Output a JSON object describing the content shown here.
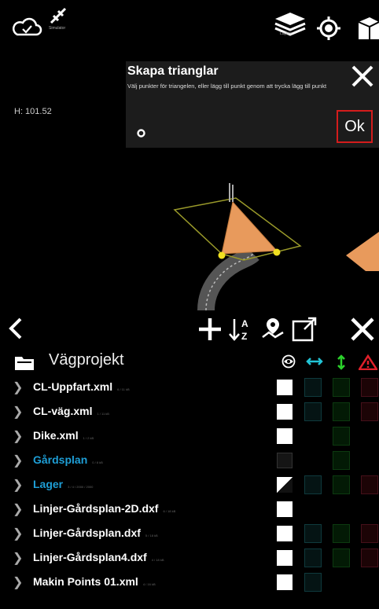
{
  "app_icons": {
    "status": "cloud-check-icon",
    "mode_icon": "satellite-icon",
    "mode_label": "Simulator",
    "layers_label": "Layers"
  },
  "viewport": {
    "height_readout": "H: 101.52"
  },
  "dialog": {
    "title": "Skapa trianglar",
    "message": "Välj punkter för triangelen, eller lägg till punkt genom att trycka lägg till punkt",
    "ok_label": "Ok"
  },
  "panel": {
    "title": "Vägprojekt",
    "rows": [
      {
        "name": "CL-Uppfart.xml",
        "size": "6 / 11 kB",
        "color": "white",
        "check": "white",
        "cyan": true,
        "green": true,
        "red": true
      },
      {
        "name": "CL-väg.xml",
        "size": "1 / 11 kB",
        "color": "white",
        "check": "white",
        "cyan": true,
        "green": true,
        "red": true
      },
      {
        "name": "Dike.xml",
        "size": "1 / 2 kB",
        "color": "white",
        "check": "white",
        "cyan": false,
        "green": true,
        "red": false
      },
      {
        "name": "Gårdsplan",
        "size": "0 / 8 kB",
        "color": "blue",
        "check": "dark",
        "cyan": false,
        "green": true,
        "red": false
      },
      {
        "name": "Lager",
        "size": "3 / 4 / 2000 / 2000",
        "color": "blue",
        "check": "half",
        "cyan": true,
        "green": true,
        "red": true
      },
      {
        "name": "Linjer-Gårdsplan-2D.dxf",
        "size": "6 / 18 kB",
        "color": "white",
        "check": "white",
        "cyan": false,
        "green": false,
        "red": false
      },
      {
        "name": "Linjer-Gårdsplan.dxf",
        "size": "5 / 18 kB",
        "color": "white",
        "check": "white",
        "cyan": true,
        "green": true,
        "red": true
      },
      {
        "name": "Linjer-Gårdsplan4.dxf",
        "size": "4 / 18 kB",
        "color": "white",
        "check": "white",
        "cyan": true,
        "green": true,
        "red": true
      },
      {
        "name": "Makin Points 01.xml",
        "size": "4 / 16 kB",
        "color": "white",
        "check": "white",
        "cyan": true,
        "green": false,
        "red": false
      }
    ]
  },
  "colors": {
    "accent_blue": "#1e9ed6",
    "triangle_fill": "#e89a5c",
    "ok_border": "#d41c1c",
    "cyan": "#22c4d6",
    "green": "#2bd12b",
    "red": "#e0202a"
  }
}
